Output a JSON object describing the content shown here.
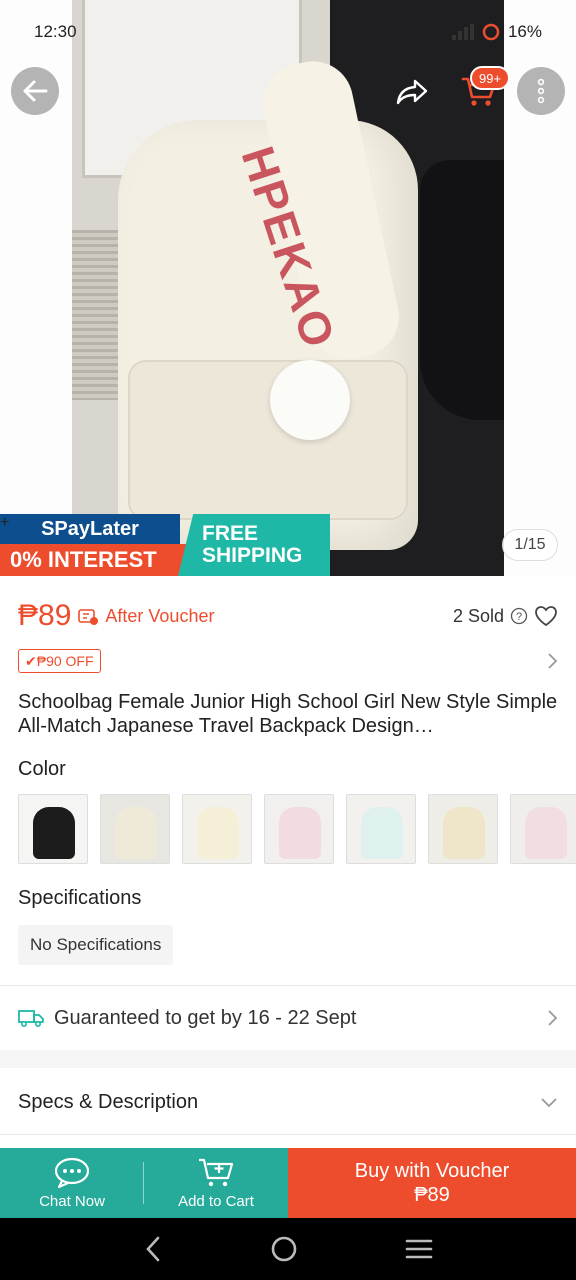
{
  "status_bar": {
    "time": "12:30",
    "battery": "16%"
  },
  "top_actions": {
    "cart_badge": "99+"
  },
  "hero": {
    "strap_text": "HPEKAO",
    "promo": {
      "spaylater": "SPayLater",
      "interest": "0% INTEREST",
      "shipping_line1": "FREE",
      "shipping_line2": "SHIPPING"
    },
    "image_counter": "1/15"
  },
  "price": {
    "amount": "₱89",
    "after_voucher": "After Voucher",
    "sold": "2 Sold",
    "discount_tag": "✔₱90 OFF"
  },
  "product": {
    "title": "Schoolbag Female Junior High School Girl New Style Simple All-Match Japanese Travel Backpack Design…"
  },
  "color": {
    "label": "Color",
    "swatches": [
      {
        "name": "black",
        "color": "#1c1c1c",
        "bg": "#f5f5f3"
      },
      {
        "name": "cream",
        "color": "#efe9da",
        "bg": "#e8e6e0"
      },
      {
        "name": "ivory",
        "color": "#f4efd6",
        "bg": "#f3f1ec"
      },
      {
        "name": "pink",
        "color": "#f3dce0",
        "bg": "#f2f0ee"
      },
      {
        "name": "mint",
        "color": "#dff1ee",
        "bg": "#f2f1ee"
      },
      {
        "name": "beige",
        "color": "#efe6c9",
        "bg": "#efede8"
      },
      {
        "name": "blush",
        "color": "#f1dde2",
        "bg": "#f0eeeb"
      }
    ]
  },
  "specifications": {
    "label": "Specifications",
    "value": "No Specifications"
  },
  "delivery": {
    "text": "Guaranteed to get by 16 - 22 Sept"
  },
  "specs_description": {
    "label": "Specs & Description"
  },
  "bottom_bar": {
    "chat_label": "Chat Now",
    "cart_label": "Add to Cart",
    "buy_label": "Buy with Voucher",
    "buy_price": "₱89"
  },
  "colors": {
    "accent": "#ee4d2d",
    "teal": "#26aa99",
    "promo_blue": "#0d4e8e",
    "promo_teal": "#1fb8a6"
  }
}
